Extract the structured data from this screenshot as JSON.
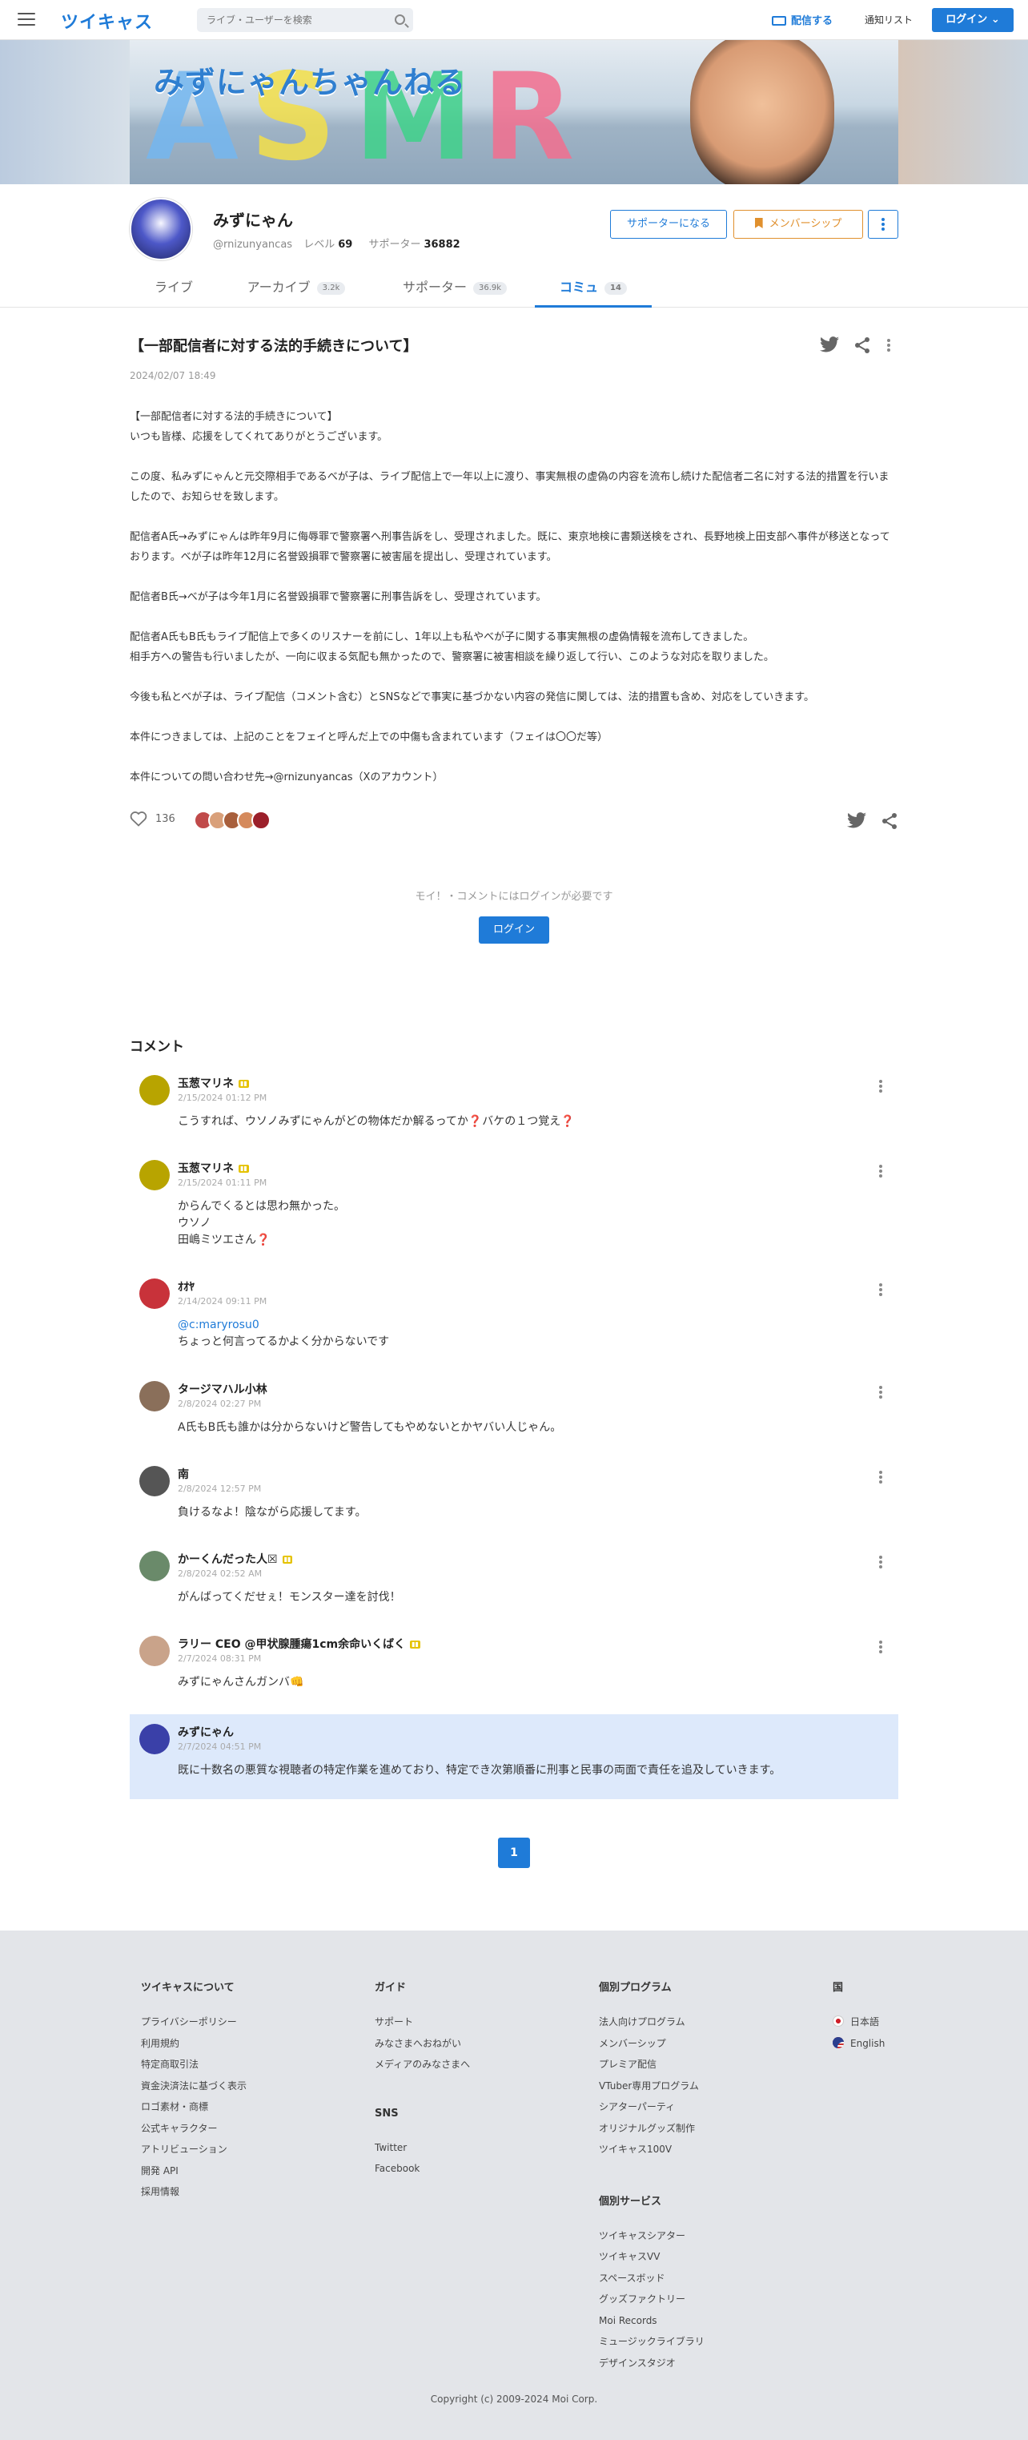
{
  "header": {
    "logo": "ツイキャス",
    "search_placeholder": "ライブ・ユーザーを検索",
    "broadcast_label": "配信する",
    "notify_label": "通知リスト",
    "login_label": "ログイン"
  },
  "banner": {
    "title": "みずにゃんちゃんねる",
    "letters": "ASMR"
  },
  "profile": {
    "name": "みずにゃん",
    "handle": "@rnizunyancas",
    "level_label": "レベル",
    "level": "69",
    "supporter_label": "サポーター",
    "supporters": "36882",
    "become_supporter": "サポーターになる",
    "membership": "メンバーシップ"
  },
  "tabs": [
    {
      "label": "ライブ",
      "count": ""
    },
    {
      "label": "アーカイブ",
      "count": "3.2k"
    },
    {
      "label": "サポーター",
      "count": "36.9k"
    },
    {
      "label": "コミュ",
      "count": "14"
    }
  ],
  "post": {
    "title": "【一部配信者に対する法的手続きについて】",
    "date": "2024/02/07 18:49",
    "paragraphs": [
      "【一部配信者に対する法的手続きについて】\nいつも皆様、応援をしてくれてありがとうございます。",
      "この度、私みずにゃんと元交際相手であるべが子は、ライブ配信上で一年以上に渡り、事実無根の虚偽の内容を流布し続けた配信者二名に対する法的措置を行いましたので、お知らせを致します。",
      "配信者A氏→みずにゃんは昨年9月に侮辱罪で警察署へ刑事告訴をし、受理されました。既に、東京地検に書類送検をされ、長野地検上田支部へ事件が移送となっております。べが子は昨年12月に名誉毀損罪で警察署に被害届を提出し、受理されています。",
      "配信者B氏→べが子は今年1月に名誉毀損罪で警察署に刑事告訴をし、受理されています。",
      "配信者A氏もB氏もライブ配信上で多くのリスナーを前にし、1年以上も私やべが子に関する事実無根の虚偽情報を流布してきました。\n相手方への警告も行いましたが、一向に収まる気配も無かったので、警察署に被害相談を繰り返して行い、このような対応を取りました。",
      "今後も私とべが子は、ライブ配信（コメント含む）とSNSなどで事実に基づかない内容の発信に関しては、法的措置も含め、対応をしていきます。",
      "本件につきましては、上記のことをフェイと呼んだ上での中傷も含まれています（フェイは〇〇だ等）",
      "本件についての問い合わせ先→@rnizunyancas（Xのアカウント）"
    ],
    "likes": "136",
    "login_note": "モイ！・コメントにはログインが必要です",
    "login_button": "ログイン"
  },
  "comments_heading": "コメント",
  "comments": [
    {
      "name": "玉葱マリネ",
      "date": "2/15/2024 01:12 PM",
      "text": "こうすれば、ウソノみずにゃんがどの物体だか解るってか❓バケの１つ覚え❓",
      "mention": "",
      "color": "#b8a400"
    },
    {
      "name": "玉葱マリネ",
      "date": "2/15/2024 01:11 PM",
      "text": "からんでくるとは思わ無かった。\nウソノ\n田嶋ミツエさん❓",
      "mention": "",
      "color": "#b8a400"
    },
    {
      "name": "ｵｵﾔ",
      "date": "2/14/2024 09:11 PM",
      "text": "ちょっと何言ってるかよく分からないです",
      "mention": "@c:maryrosu0",
      "color": "#c8323a"
    },
    {
      "name": "タージマハル小林",
      "date": "2/8/2024 02:27 PM",
      "text": "A氏もB氏も誰かは分からないけど警告してもやめないとかヤバい人じゃん。",
      "mention": "",
      "color": "#8a6f5a"
    },
    {
      "name": "南",
      "date": "2/8/2024 12:57 PM",
      "text": "負けるなよ！陰ながら応援してます。",
      "mention": "",
      "color": "#555555"
    },
    {
      "name": "かーくんだった人☒",
      "date": "2/8/2024 02:52 AM",
      "text": "がんばってくだせぇ！モンスター達を討伐！",
      "mention": "",
      "color": "#6a8a6a"
    },
    {
      "name": "ラリー CEO @甲状腺腫瘍1cm余命いくばく",
      "date": "2/7/2024 08:31 PM",
      "text": "みずにゃんさんガンバ👊",
      "mention": "",
      "color": "#c9a38a"
    },
    {
      "name": "みずにゃん",
      "date": "2/7/2024 04:51 PM",
      "text": "既に十数名の悪質な視聴者の特定作業を進めており、特定でき次第順番に刑事と民事の両面で責任を追及していきます。",
      "mention": "",
      "color": "#3a40a8"
    }
  ],
  "pagination": {
    "current": "1"
  },
  "footer": {
    "about": {
      "heading": "ツイキャスについて",
      "links": [
        "プライバシーポリシー",
        "利用規約",
        "特定商取引法",
        "資金決済法に基づく表示",
        "ロゴ素材・商標",
        "公式キャラクター",
        "アトリビューション",
        "開発 API",
        "採用情報"
      ]
    },
    "guide": {
      "heading": "ガイド",
      "links": [
        "サポート",
        "みなさまへおねがい",
        "メディアのみなさまへ"
      ]
    },
    "sns": {
      "heading": "SNS",
      "links": [
        "Twitter",
        "Facebook"
      ]
    },
    "programs": {
      "heading": "個別プログラム",
      "links": [
        "法人向けプログラム",
        "メンバーシップ",
        "プレミア配信",
        "VTuber専用プログラム",
        "シアターパーティ",
        "オリジナルグッズ制作",
        "ツイキャス100V"
      ]
    },
    "services": {
      "heading": "個別サービス",
      "links": [
        "ツイキャスシアター",
        "ツイキャスVV",
        "スペースボッド",
        "グッズファクトリー",
        "Moi Records",
        "ミュージックライブラリ",
        "デザインスタジオ"
      ]
    },
    "country": {
      "heading": "国",
      "links": [
        "日本語",
        "English"
      ]
    },
    "copyright": "Copyright (c) 2009-2024 Moi Corp."
  }
}
